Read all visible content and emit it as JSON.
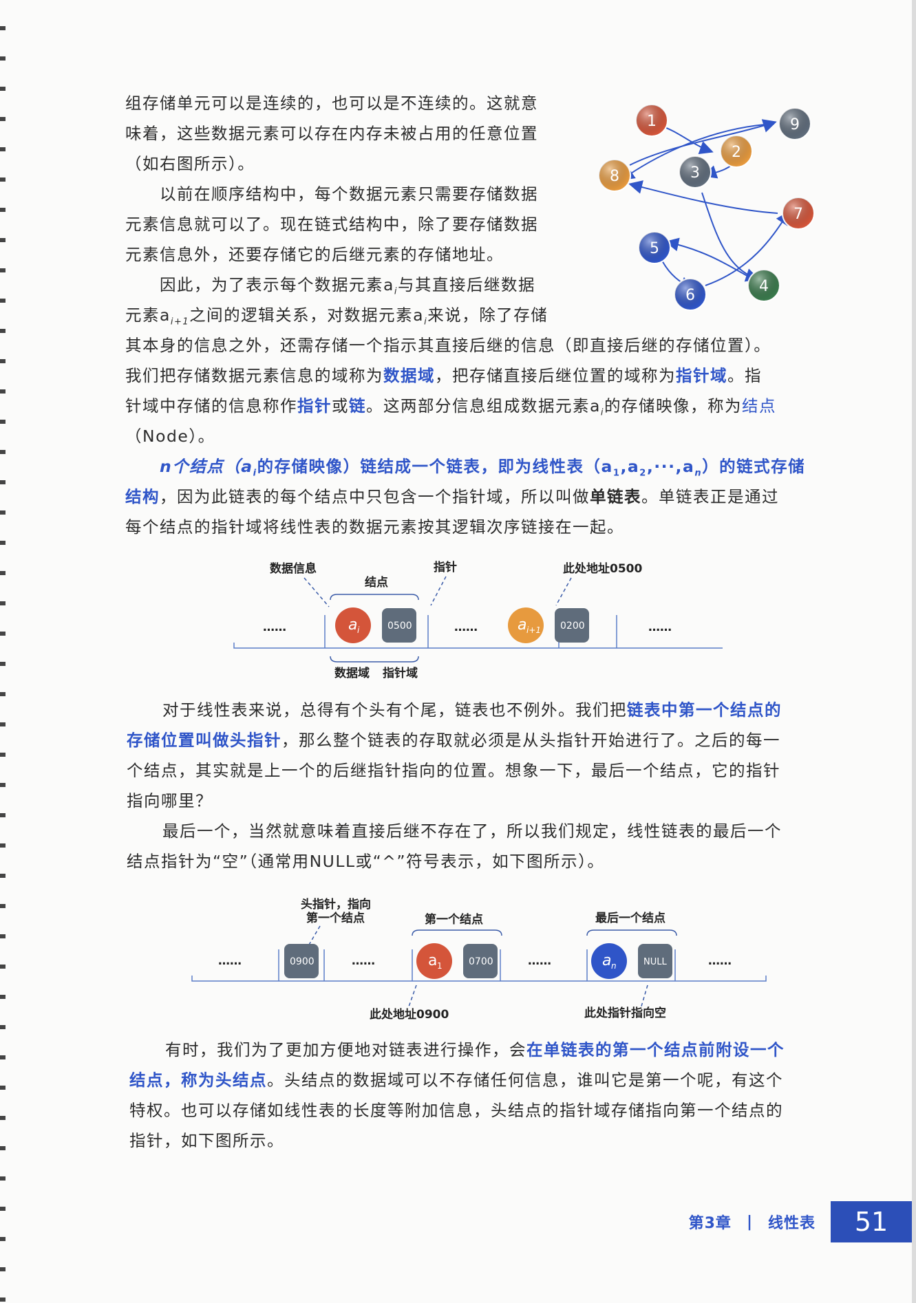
{
  "para1": [
    "组存储单元可以是连续的，也可以是不连续的。这就意",
    "味着，这些数据元素可以存在内存未被占用的任意位置",
    "（如右图所示）。"
  ],
  "para2": [
    "以前在顺序结构中，每个数据元素只需要存储数据",
    "元素信息就可以了。现在链式结构中，除了要存储数据",
    "元素信息外，还要存储它的后继元素的存储地址。"
  ],
  "para3": {
    "l1_a": "因此，为了表示每个数据元素a",
    "l1_sub": "i",
    "l1_b": "与其直接后继数据",
    "l2_a": "元素a",
    "l2_sub": "i+1",
    "l2_b": "之间的逻辑关系，对数据元素a",
    "l2_sub2": "i",
    "l2_c": "来说，除了存储",
    "l3": "其本身的信息之外，还需存储一个指示其直接后继的信息（即直接后继的存储位置）。",
    "l4_a": "我们把存储数据元素信息的域称为",
    "l4_em1": "数据域",
    "l4_b": "，把存储直接后继位置的域称为",
    "l4_em2": "指针域",
    "l4_c": "。指",
    "l5_a": "针域中存储的信息称作",
    "l5_em1": "指针",
    "l5_b": "或",
    "l5_em2": "链",
    "l5_c": "。这两部分信息组成数据元素a",
    "l5_sub": "i",
    "l5_d": "的存储映像，称为",
    "l5_em3": "结点",
    "l6": "（Node）。"
  },
  "para4": {
    "l1_em": "n个结点（a",
    "l1_sub": "i",
    "l1_em_b": "的存储映像）链结成一个链表，即为线性表（a",
    "s1": "1",
    "c1": ",a",
    "s2": "2",
    "c2": ",···,a",
    "s3": "n",
    "c3": "）的链式存储",
    "l2_em": "结构",
    "l2_a": "，因为此链表的每个结点中只包含一个指针域，所以叫做",
    "l2_b": "单链表",
    "l2_c": "。单链表正是通过",
    "l3": "每个结点的指针域将线性表的数据元素按其逻辑次序链接在一起。"
  },
  "graph_nodes": [
    {
      "label": "1",
      "color": "#d4553a"
    },
    {
      "label": "9",
      "color": "#5f6c7b"
    },
    {
      "label": "2",
      "color": "#e79a3e"
    },
    {
      "label": "3",
      "color": "#5f6c7b"
    },
    {
      "label": "8",
      "color": "#e79a3e"
    },
    {
      "label": "7",
      "color": "#d4553a"
    },
    {
      "label": "5",
      "color": "#2f55c8"
    },
    {
      "label": "4",
      "color": "#3a7a4c"
    },
    {
      "label": "6",
      "color": "#2f55c8"
    }
  ],
  "fig1": {
    "data_info": "数据信息",
    "node": "结点",
    "pointer": "指针",
    "addr_note": "此处地址0500",
    "dots": "……",
    "ai": "a",
    "ai_sub": "i",
    "ptr1": "0500",
    "ai1": "a",
    "ai1_sub": "i+1",
    "ptr2": "0200",
    "data_field": "数据域",
    "pointer_field": "指针域"
  },
  "para5": {
    "l1_a": "对于线性表来说，总得有个头有个尾，链表也不例外。我们把",
    "l1_em": "链表中第一个结点的",
    "l2_em": "存储位置叫做头指针",
    "l2_a": "，那么整个链表的存取就必须是从头指针开始进行了。之后的每一",
    "l3": "个结点，其实就是上一个的后继指针指向的位置。想象一下，最后一个结点，它的指针",
    "l4": "指向哪里？"
  },
  "para6": [
    "最后一个，当然就意味着直接后继不存在了，所以我们规定，线性链表的最后一个",
    "结点指针为“空”（通常用NULL或“^”符号表示，如下图所示）。"
  ],
  "fig2": {
    "head_label_1": "头指针，指向",
    "head_label_2": "第一个结点",
    "first_node": "第一个结点",
    "last_node": "最后一个结点",
    "dots": "……",
    "p0900": "0900",
    "a1": "a",
    "a1_sub": "1",
    "p0700": "0700",
    "an": "a",
    "an_sub": "n",
    "null": "NULL",
    "addr_note": "此处地址0900",
    "null_note": "此处指针指向空"
  },
  "para7": {
    "l1_a": "有时，我们为了更加方便地对链表进行操作，会",
    "l1_em": "在单链表的第一个结点前附设一个",
    "l2_em": "结点，称为头结点",
    "l2_a": "。头结点的数据域可以不存储任何信息，谁叫它是第一个呢，有这个",
    "l3": "特权。也可以存储如线性表的长度等附加信息，头结点的指针域存储指向第一个结点的",
    "l4": "指针，如下图所示。"
  },
  "footer": {
    "chapter": "第3章",
    "sep": "|",
    "title": "线性表",
    "page": "51"
  }
}
